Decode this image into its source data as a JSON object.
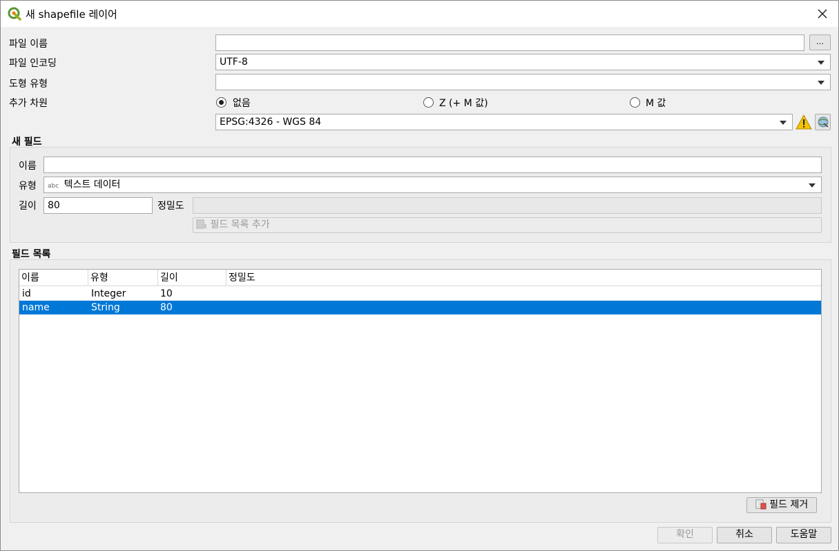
{
  "window": {
    "title": "새 shapefile 레이어"
  },
  "form": {
    "file_name_label": "파일 이름",
    "file_name_value": "",
    "browse_label": "…",
    "encoding_label": "파일 인코딩",
    "encoding_value": "UTF-8",
    "geometry_type_label": "도형 유형",
    "geometry_type_value": "",
    "dimension_label": "추가 차원",
    "dimension_options": [
      {
        "label": "없음",
        "checked": true
      },
      {
        "label": "Z (+ M 값)",
        "checked": false
      },
      {
        "label": "M 값",
        "checked": false
      }
    ],
    "crs_value": "EPSG:4326 - WGS 84"
  },
  "new_field": {
    "title": "새 필드",
    "name_label": "이름",
    "name_value": "",
    "type_label": "유형",
    "type_icon_text": "abc",
    "type_value": "텍스트 데이터",
    "length_label": "길이",
    "length_value": "80",
    "precision_label": "정밀도",
    "precision_value": "",
    "add_button_label": "필드 목록 추가"
  },
  "field_list": {
    "title": "필드 목록",
    "columns": [
      "이름",
      "유형",
      "길이",
      "정밀도"
    ],
    "rows": [
      {
        "name": "id",
        "type": "Integer",
        "length": "10",
        "precision": ""
      },
      {
        "name": "name",
        "type": "String",
        "length": "80",
        "precision": ""
      }
    ],
    "selected_row": 1,
    "remove_button_label": "필드 제거"
  },
  "footer": {
    "ok_label": "확인",
    "cancel_label": "취소",
    "help_label": "도움말"
  },
  "colors": {
    "selection": "#0078d7",
    "warning": "#f5c400"
  }
}
